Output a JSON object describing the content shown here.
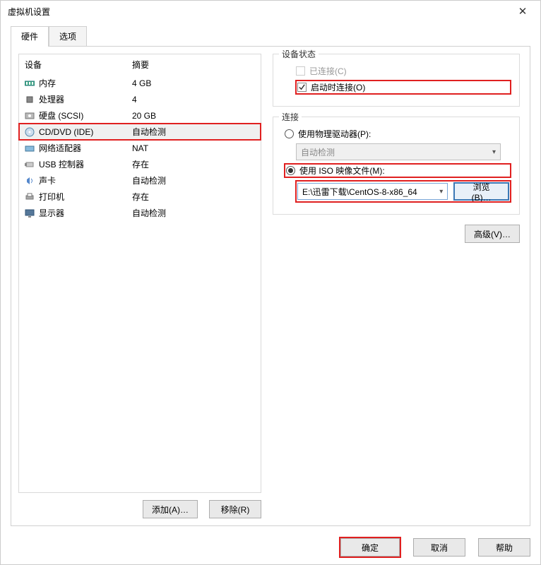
{
  "window": {
    "title": "虚拟机设置"
  },
  "tabs": {
    "hardware": "硬件",
    "options": "选项"
  },
  "hwlist": {
    "header": {
      "device": "设备",
      "summary": "摘要"
    },
    "rows": [
      {
        "name": "内存",
        "summary": "4 GB",
        "icon": "memory"
      },
      {
        "name": "处理器",
        "summary": "4",
        "icon": "cpu"
      },
      {
        "name": "硬盘 (SCSI)",
        "summary": "20 GB",
        "icon": "disk"
      },
      {
        "name": "CD/DVD (IDE)",
        "summary": "自动检测",
        "icon": "cd",
        "selected": true,
        "highlight": true
      },
      {
        "name": "网络适配器",
        "summary": "NAT",
        "icon": "net"
      },
      {
        "name": "USB 控制器",
        "summary": "存在",
        "icon": "usb"
      },
      {
        "name": "声卡",
        "summary": "自动检测",
        "icon": "sound"
      },
      {
        "name": "打印机",
        "summary": "存在",
        "icon": "printer"
      },
      {
        "name": "显示器",
        "summary": "自动检测",
        "icon": "display"
      }
    ]
  },
  "left_buttons": {
    "add": "添加(A)…",
    "remove": "移除(R)"
  },
  "status": {
    "legend": "设备状态",
    "connected": "已连接(C)",
    "connect_at_power": "启动时连接(O)"
  },
  "connection": {
    "legend": "连接",
    "physical": "使用物理驱动器(P):",
    "physical_value": "自动检测",
    "iso": "使用 ISO 映像文件(M):",
    "iso_value": "E:\\迅雷下载\\CentOS-8-x86_64",
    "browse": "浏览(B)…"
  },
  "advanced": "高级(V)…",
  "footer": {
    "ok": "确定",
    "cancel": "取消",
    "help": "帮助"
  }
}
